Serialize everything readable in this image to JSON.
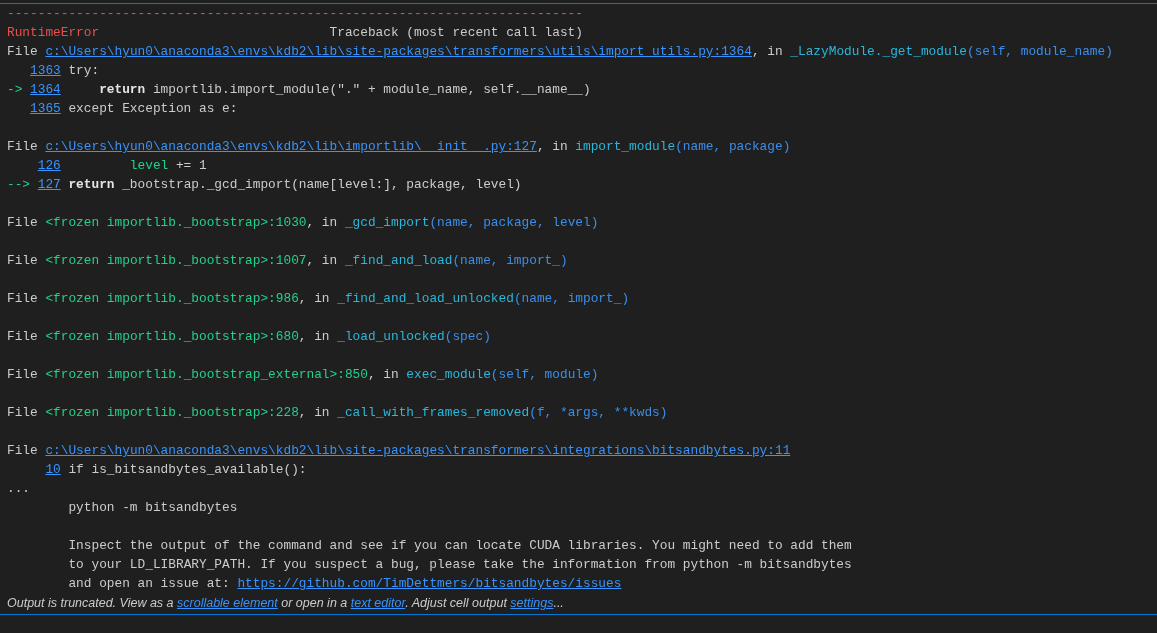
{
  "output": {
    "lines": [
      {
        "kind": "text",
        "segments": [
          {
            "text": "---------------------------------------------------------------------------",
            "kind": "error"
          }
        ]
      },
      {
        "kind": "text",
        "segments": [
          {
            "text": "RuntimeError",
            "kind": "error"
          },
          {
            "text": "Traceback (most recent call last)",
            "kind": "heading"
          }
        ]
      },
      {
        "kind": "text",
        "segments": [
          {
            "text": "File ",
            "kind": "plain"
          },
          {
            "text": "c:\\Users\\hyun0\\anaconda3\\envs\\kdb2\\lib\\site-packages\\transformers\\utils\\import_utils.py:1364",
            "kind": "link"
          },
          {
            "text": ", in ",
            "kind": "plain"
          },
          {
            "text": "_LazyModule._get_module",
            "kind": "func"
          },
          {
            "text": "(self, module_name)",
            "kind": "args"
          }
        ]
      },
      {
        "kind": "source",
        "lineno": "1363",
        "segments": [
          {
            "text": " try:",
            "kind": "plain"
          }
        ]
      },
      {
        "kind": "source",
        "marker": "->",
        "lineno": "1364",
        "segments": [
          {
            "text": "     return",
            "kind": "keyword"
          },
          {
            "text": " importlib.import_module(\".\" + module_name, self.__name__)",
            "kind": "plain"
          }
        ]
      },
      {
        "kind": "source",
        "lineno": "1365",
        "segments": [
          {
            "text": " except Exception as e:",
            "kind": "plain"
          }
        ]
      },
      {
        "kind": "blank"
      },
      {
        "kind": "text",
        "segments": [
          {
            "text": "File ",
            "kind": "plain"
          },
          {
            "text": "c:\\Users\\hyun0\\anaconda3\\envs\\kdb2\\lib\\importlib\\__init__.py:127",
            "kind": "link"
          },
          {
            "text": ", in ",
            "kind": "plain"
          },
          {
            "text": "import_module",
            "kind": "func"
          },
          {
            "text": "(name, package)",
            "kind": "args"
          }
        ]
      },
      {
        "kind": "source",
        "lineno": "126",
        "segments": [
          {
            "text": "         level",
            "kind": "green"
          },
          {
            "text": " += 1",
            "kind": "plain"
          }
        ]
      },
      {
        "kind": "source",
        "marker": "-->",
        "lineno": "127",
        "segments": [
          {
            "text": " return",
            "kind": "keyword"
          },
          {
            "text": " _bootstrap._gcd_import(name[level:], package, level)",
            "kind": "plain"
          }
        ]
      },
      {
        "kind": "blank"
      },
      {
        "kind": "text",
        "segments": [
          {
            "text": "File ",
            "kind": "plain"
          },
          {
            "text": "<frozen importlib._bootstrap>:1030",
            "kind": "green"
          },
          {
            "text": ", in ",
            "kind": "plain"
          },
          {
            "text": "_gcd_import",
            "kind": "func"
          },
          {
            "text": "(name, package, level)",
            "kind": "args"
          }
        ]
      },
      {
        "kind": "blank"
      },
      {
        "kind": "text",
        "segments": [
          {
            "text": "File ",
            "kind": "plain"
          },
          {
            "text": "<frozen importlib._bootstrap>:1007",
            "kind": "green"
          },
          {
            "text": ", in ",
            "kind": "plain"
          },
          {
            "text": "_find_and_load",
            "kind": "func"
          },
          {
            "text": "(name, import_)",
            "kind": "args"
          }
        ]
      },
      {
        "kind": "blank"
      },
      {
        "kind": "text",
        "segments": [
          {
            "text": "File ",
            "kind": "plain"
          },
          {
            "text": "<frozen importlib._bootstrap>:986",
            "kind": "green"
          },
          {
            "text": ", in ",
            "kind": "plain"
          },
          {
            "text": "_find_and_load_unlocked",
            "kind": "func"
          },
          {
            "text": "(name, import_)",
            "kind": "args"
          }
        ]
      },
      {
        "kind": "blank"
      },
      {
        "kind": "text",
        "segments": [
          {
            "text": "File ",
            "kind": "plain"
          },
          {
            "text": "<frozen importlib._bootstrap>:680",
            "kind": "green"
          },
          {
            "text": ", in ",
            "kind": "plain"
          },
          {
            "text": "_load_unlocked",
            "kind": "func"
          },
          {
            "text": "(spec)",
            "kind": "args"
          }
        ]
      },
      {
        "kind": "blank"
      },
      {
        "kind": "text",
        "segments": [
          {
            "text": "File ",
            "kind": "plain"
          },
          {
            "text": "<frozen importlib._bootstrap_external>:850",
            "kind": "green"
          },
          {
            "text": ", in ",
            "kind": "plain"
          },
          {
            "text": "exec_module",
            "kind": "func"
          },
          {
            "text": "(self, module)",
            "kind": "args"
          }
        ]
      },
      {
        "kind": "blank"
      },
      {
        "kind": "text",
        "segments": [
          {
            "text": "File ",
            "kind": "plain"
          },
          {
            "text": "<frozen importlib._bootstrap>:228",
            "kind": "green"
          },
          {
            "text": ", in ",
            "kind": "plain"
          },
          {
            "text": "_call_with_frames_removed",
            "kind": "func"
          },
          {
            "text": "(f, *args, **kwds)",
            "kind": "args"
          }
        ]
      },
      {
        "kind": "blank"
      },
      {
        "kind": "text",
        "segments": [
          {
            "text": "File ",
            "kind": "plain"
          },
          {
            "text": "c:\\Users\\hyun0\\anaconda3\\envs\\kdb2\\lib\\site-packages\\transformers\\integrations\\bitsandbytes.py:11",
            "kind": "link"
          }
        ]
      },
      {
        "kind": "source",
        "lineno": "10",
        "segments": [
          {
            "text": " if is_bitsandbytes_available():",
            "kind": "plain"
          }
        ]
      },
      {
        "kind": "text",
        "segments": [
          {
            "text": "...",
            "kind": "plain"
          }
        ]
      },
      {
        "kind": "text",
        "segments": [
          {
            "text": "        python -m bitsandbytes",
            "kind": "plain"
          }
        ]
      },
      {
        "kind": "blank"
      },
      {
        "kind": "text",
        "segments": [
          {
            "text": "        Inspect the output of the command and see if you can locate CUDA libraries. You might need to add them",
            "kind": "plain"
          }
        ]
      },
      {
        "kind": "text",
        "segments": [
          {
            "text": "        to your LD_LIBRARY_PATH. If you suspect a bug, please take the information from python -m bitsandbytes",
            "kind": "plain"
          }
        ]
      },
      {
        "kind": "text",
        "segments": [
          {
            "text": "        and open an issue at: ",
            "kind": "plain"
          },
          {
            "text": "https://github.com/TimDettmers/bitsandbytes/issues",
            "kind": "link"
          }
        ]
      }
    ]
  },
  "truncation_notice": [
    {
      "text": "Output is truncated. View as a ",
      "kind": "plain"
    },
    {
      "text": "scrollable element",
      "kind": "link"
    },
    {
      "text": " or open in a ",
      "kind": "plain"
    },
    {
      "text": "text editor",
      "kind": "link"
    },
    {
      "text": ". Adjust cell output ",
      "kind": "plain"
    },
    {
      "text": "settings",
      "kind": "link"
    },
    {
      "text": "...",
      "kind": "plain"
    }
  ]
}
